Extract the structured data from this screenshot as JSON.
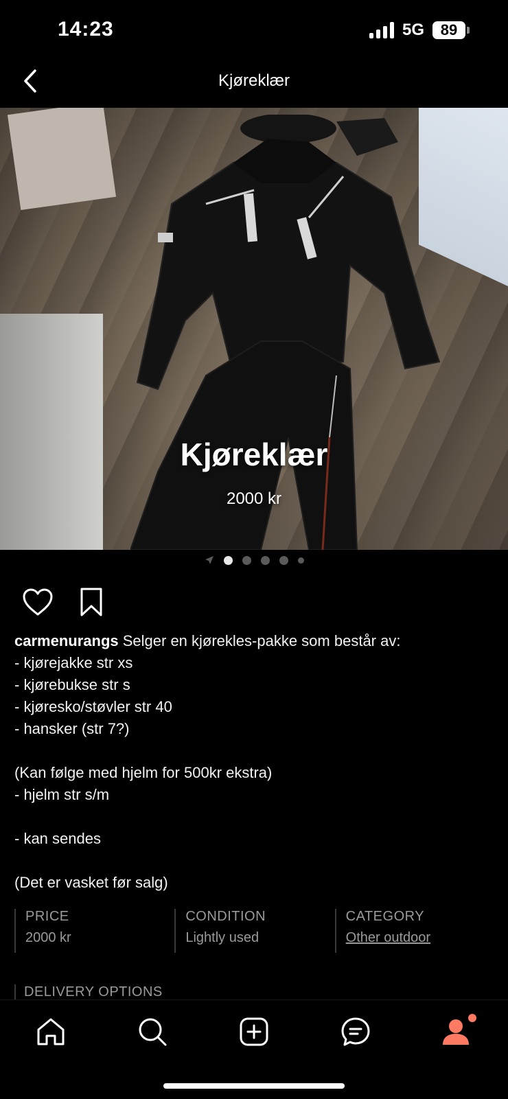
{
  "status_bar": {
    "time": "14:23",
    "network": "5G",
    "battery": "89"
  },
  "nav": {
    "title": "Kjøreklær"
  },
  "hero": {
    "title": "Kjøreklær",
    "price": "2000 kr"
  },
  "pager": {
    "count": 5,
    "active_index": 0
  },
  "post": {
    "username": "carmenurangs",
    "description": " Selger en kjørekles-pakke som består av:\n- kjørejakke str xs\n- kjørebukse str s\n- kjøresko/støvler str 40\n- hansker (str 7?)\n\n(Kan følge med hjelm for 500kr ekstra)\n- hjelm str s/m\n\n- kan sendes\n\n(Det er vasket før salg)"
  },
  "details": {
    "price_label": "PRICE",
    "price_value": "2000 kr",
    "condition_label": "CONDITION",
    "condition_value": "Lightly used",
    "category_label": "CATEGORY",
    "category_value": "Other outdoor",
    "delivery_label": "DELIVERY OPTIONS"
  },
  "tabs": [
    "home-icon",
    "search-icon",
    "add-icon",
    "messages-icon",
    "profile-icon"
  ],
  "colors": {
    "accent": "#ff7a63",
    "background": "#000000"
  }
}
